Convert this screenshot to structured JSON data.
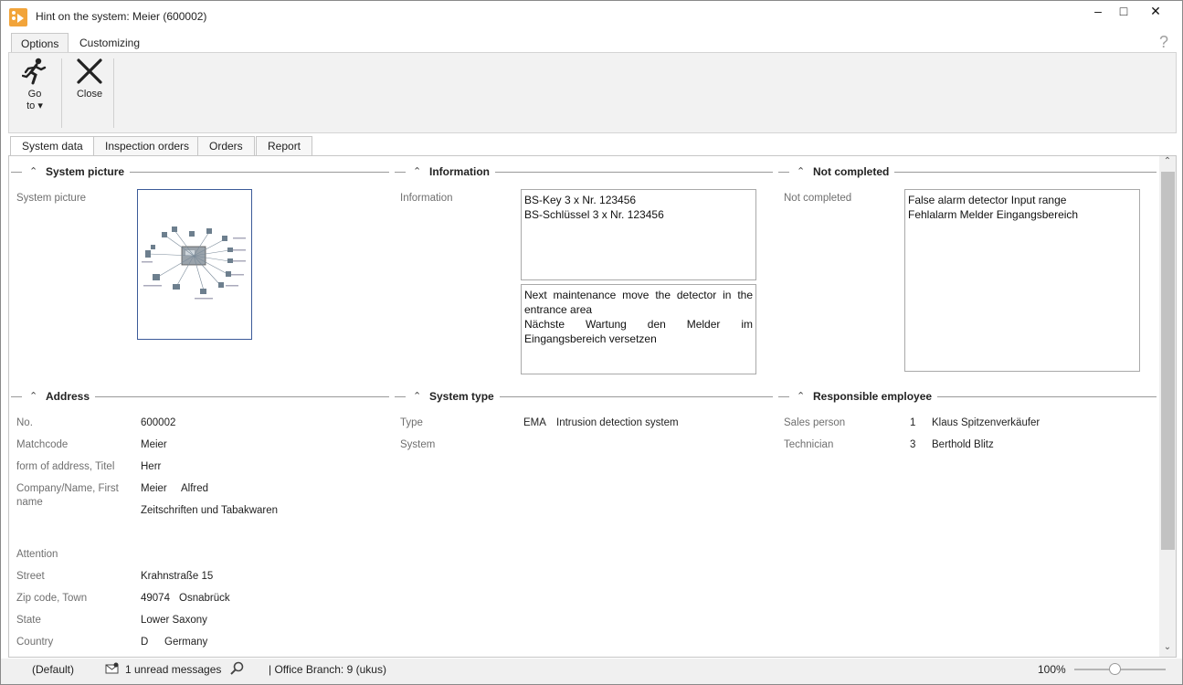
{
  "window": {
    "title": "Hint on the system: Meier (600002)",
    "minimize_glyph": "–",
    "maximize_glyph": "□",
    "close_glyph": "✕"
  },
  "ribbon": {
    "tabs": [
      {
        "label": "Options",
        "active": true
      },
      {
        "label": "Customizing",
        "active": false
      }
    ],
    "help_glyph": "?",
    "buttons": {
      "goto_line1": "Go",
      "goto_line2": "to ▾",
      "close": "Close"
    }
  },
  "content_tabs": [
    {
      "label": "System data",
      "active": true
    },
    {
      "label": "Inspection orders",
      "active": false
    },
    {
      "label": "Orders",
      "active": false
    },
    {
      "label": "Report",
      "active": false
    }
  ],
  "sections": {
    "system_picture": {
      "title": "System picture",
      "label": "System picture"
    },
    "information": {
      "title": "Information",
      "label": "Information",
      "box1": [
        "BS-Key 3 x Nr. 123456",
        "BS-Schlüssel 3 x Nr. 123456"
      ],
      "box2_line1": "Next maintenance move the detector in the",
      "box2_line2": "entrance area",
      "box2_line3": "Nächste Wartung den Melder im",
      "box2_line4": "Eingangsbereich versetzen"
    },
    "not_completed": {
      "title": "Not completed",
      "label": "Not completed",
      "box": [
        "False alarm detector Input range",
        "Fehlalarm Melder Eingangsbereich"
      ]
    },
    "address": {
      "title": "Address",
      "no_label": "No.",
      "no_value": "600002",
      "matchcode_label": "Matchcode",
      "matchcode_value": "Meier",
      "form_label": "form of address, Titel",
      "form_value": "Herr",
      "company_label_1": "Company/Name, First",
      "company_label_2": "name",
      "company_name": "Meier",
      "first_name": "Alfred",
      "company_line2": "Zeitschriften und Tabakwaren",
      "attention_label": "Attention",
      "street_label": "Street",
      "street_value": "Krahnstraße 15",
      "zip_label": "Zip code, Town",
      "zip_value": "49074",
      "town_value": "Osnabrück",
      "state_label": "State",
      "state_value": "Lower Saxony",
      "country_label": "Country",
      "country_code": "D",
      "country_value": "Germany"
    },
    "system_type": {
      "title": "System type",
      "type_label": "Type",
      "type_code": "EMA",
      "type_value": "Intrusion detection system",
      "system_label": "System"
    },
    "responsible": {
      "title": "Responsible employee",
      "sales_label": "Sales person",
      "sales_no": "1",
      "sales_name": "Klaus Spitzenverkäufer",
      "tech_label": "Technician",
      "tech_no": "3",
      "tech_name": "Berthold Blitz"
    }
  },
  "statusbar": {
    "profile": "(Default)",
    "messages": "1 unread messages",
    "branch": "| Office Branch:  9 (ukus)",
    "zoom": "100%",
    "zoom_level": 0.5
  },
  "colors": {
    "accent_orange": "#f2a43a",
    "picture_border": "#3c5a99"
  }
}
